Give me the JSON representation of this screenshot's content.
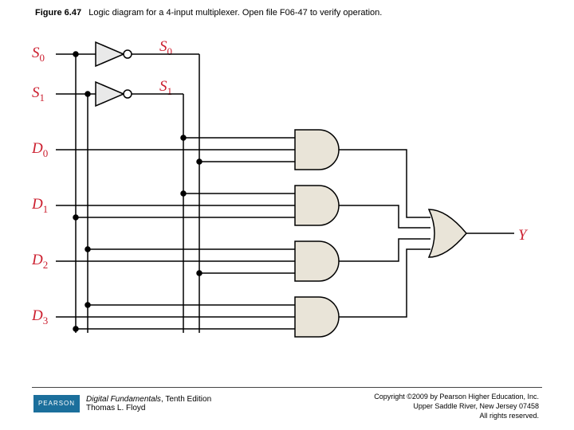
{
  "caption": {
    "fignum": "Figure 6.47",
    "text": "Logic diagram for a 4-input multiplexer. Open file F06-47 to verify operation."
  },
  "labels": {
    "S0": "S",
    "S0sub": "0",
    "S0bar": "S",
    "S0barsub": "0",
    "S1": "S",
    "S1sub": "1",
    "S1bar": "S",
    "S1barsub": "1",
    "D0": "D",
    "D0sub": "0",
    "D1": "D",
    "D1sub": "1",
    "D2": "D",
    "D2sub": "2",
    "D3": "D",
    "D3sub": "3",
    "Y": "Y"
  },
  "footer": {
    "logo": "PEARSON",
    "book_title": "Digital Fundamentals",
    "book_ed": ", Tenth Edition",
    "author": "Thomas L. Floyd",
    "c1": "Copyright ©2009 by Pearson Higher Education, Inc.",
    "c2": "Upper Saddle River, New Jersey 07458",
    "c3": "All rights reserved."
  },
  "chart_data": {
    "type": "diagram",
    "title": "4-input multiplexer logic diagram",
    "inputs": [
      "S0",
      "S1",
      "D0",
      "D1",
      "D2",
      "D3"
    ],
    "output": "Y",
    "gates": [
      {
        "name": "NOT0",
        "type": "NOT",
        "in": [
          "S0"
        ],
        "out": "S0_bar"
      },
      {
        "name": "NOT1",
        "type": "NOT",
        "in": [
          "S1"
        ],
        "out": "S1_bar"
      },
      {
        "name": "AND0",
        "type": "AND3",
        "in": [
          "D0",
          "S1_bar",
          "S0_bar"
        ],
        "out": "a0"
      },
      {
        "name": "AND1",
        "type": "AND3",
        "in": [
          "D1",
          "S1_bar",
          "S0"
        ],
        "out": "a1"
      },
      {
        "name": "AND2",
        "type": "AND3",
        "in": [
          "D2",
          "S1",
          "S0_bar"
        ],
        "out": "a2"
      },
      {
        "name": "AND3",
        "type": "AND3",
        "in": [
          "D3",
          "S1",
          "S0"
        ],
        "out": "a3"
      },
      {
        "name": "OR",
        "type": "OR4",
        "in": [
          "a0",
          "a1",
          "a2",
          "a3"
        ],
        "out": "Y"
      }
    ]
  }
}
